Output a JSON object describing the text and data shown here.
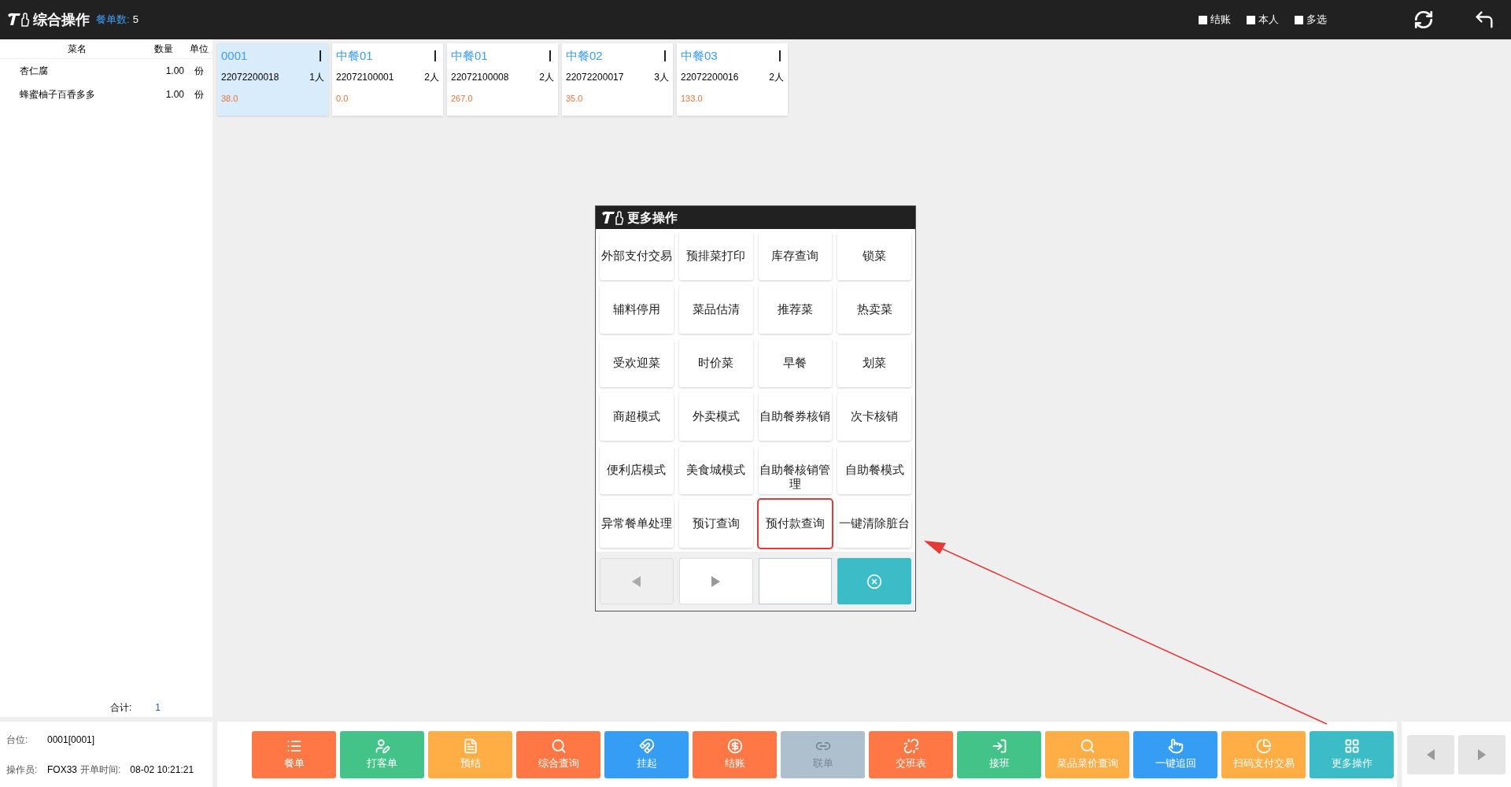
{
  "header": {
    "title": "综合操作",
    "order_count_label": "餐单数:",
    "order_count": "5",
    "checkboxes": [
      {
        "label": "结账",
        "checked": false
      },
      {
        "label": "本人",
        "checked": false
      },
      {
        "label": "多选",
        "checked": false
      }
    ]
  },
  "dish_list": {
    "columns": [
      "菜名",
      "数量",
      "单位"
    ],
    "rows": [
      {
        "name": "杏仁腐",
        "qty": "1.00",
        "unit": "份"
      },
      {
        "name": "蜂蜜柚子百香多多",
        "qty": "1.00",
        "unit": "份"
      }
    ],
    "total_label": "合计:",
    "total": "1"
  },
  "info": {
    "table_label": "台位:",
    "table": "0001[0001]",
    "operator_label": "操作员:",
    "operator": "FOX33",
    "open_time_label": "开单时间:",
    "open_time": "08-02 10:21:21"
  },
  "orders": [
    {
      "name": "0001",
      "number": "22072200018",
      "people": "1人",
      "amount": "38.0",
      "selected": true
    },
    {
      "name": "中餐01",
      "number": "22072100001",
      "people": "2人",
      "amount": "0.0",
      "selected": false
    },
    {
      "name": "中餐01",
      "number": "22072100008",
      "people": "2人",
      "amount": "267.0",
      "selected": false
    },
    {
      "name": "中餐02",
      "number": "22072200017",
      "people": "3人",
      "amount": "35.0",
      "selected": false
    },
    {
      "name": "中餐03",
      "number": "22072200016",
      "people": "2人",
      "amount": "133.0",
      "selected": false
    }
  ],
  "dialog": {
    "title": "更多操作",
    "items": [
      {
        "label": "外部支付交易",
        "highlighted": false
      },
      {
        "label": "预排菜打印",
        "highlighted": false
      },
      {
        "label": "库存查询",
        "highlighted": false
      },
      {
        "label": "锁菜",
        "highlighted": false
      },
      {
        "label": "辅料停用",
        "highlighted": false
      },
      {
        "label": "菜品估清",
        "highlighted": false
      },
      {
        "label": "推荐菜",
        "highlighted": false
      },
      {
        "label": "热卖菜",
        "highlighted": false
      },
      {
        "label": "受欢迎菜",
        "highlighted": false
      },
      {
        "label": "时价菜",
        "highlighted": false
      },
      {
        "label": "早餐",
        "highlighted": false
      },
      {
        "label": "划菜",
        "highlighted": false
      },
      {
        "label": "商超模式",
        "highlighted": false
      },
      {
        "label": "外卖模式",
        "highlighted": false
      },
      {
        "label": "自助餐券核销",
        "highlighted": false
      },
      {
        "label": "次卡核销",
        "highlighted": false
      },
      {
        "label": "便利店模式",
        "highlighted": false
      },
      {
        "label": "美食城模式",
        "highlighted": false
      },
      {
        "label": "自助餐核销管理",
        "highlighted": false
      },
      {
        "label": "自助餐模式",
        "highlighted": false
      },
      {
        "label": "异常餐单处理",
        "highlighted": false
      },
      {
        "label": "预订查询",
        "highlighted": false
      },
      {
        "label": "预付款查询",
        "highlighted": true
      },
      {
        "label": "一键清除脏台",
        "highlighted": false
      }
    ]
  },
  "toolbar": [
    {
      "label": "餐单",
      "color": "#ff7744",
      "disabled": false
    },
    {
      "label": "打客单",
      "color": "#44c389",
      "disabled": false
    },
    {
      "label": "预结",
      "color": "#ffad44",
      "disabled": false
    },
    {
      "label": "综合查询",
      "color": "#ff7744",
      "disabled": false
    },
    {
      "label": "挂起",
      "color": "#369df5",
      "disabled": false
    },
    {
      "label": "结账",
      "color": "#ff7744",
      "disabled": false
    },
    {
      "label": "联单",
      "color": "#aebfcd",
      "disabled": true
    },
    {
      "label": "交班表",
      "color": "#ff7744",
      "disabled": false
    },
    {
      "label": "接班",
      "color": "#44c389",
      "disabled": false
    },
    {
      "label": "菜品菜价查询",
      "color": "#ffad44",
      "disabled": false
    },
    {
      "label": "一键追回",
      "color": "#369df5",
      "disabled": false
    },
    {
      "label": "扫码支付交易",
      "color": "#ffad44",
      "disabled": false
    },
    {
      "label": "更多操作",
      "color": "#3bbcc6",
      "disabled": false
    }
  ]
}
